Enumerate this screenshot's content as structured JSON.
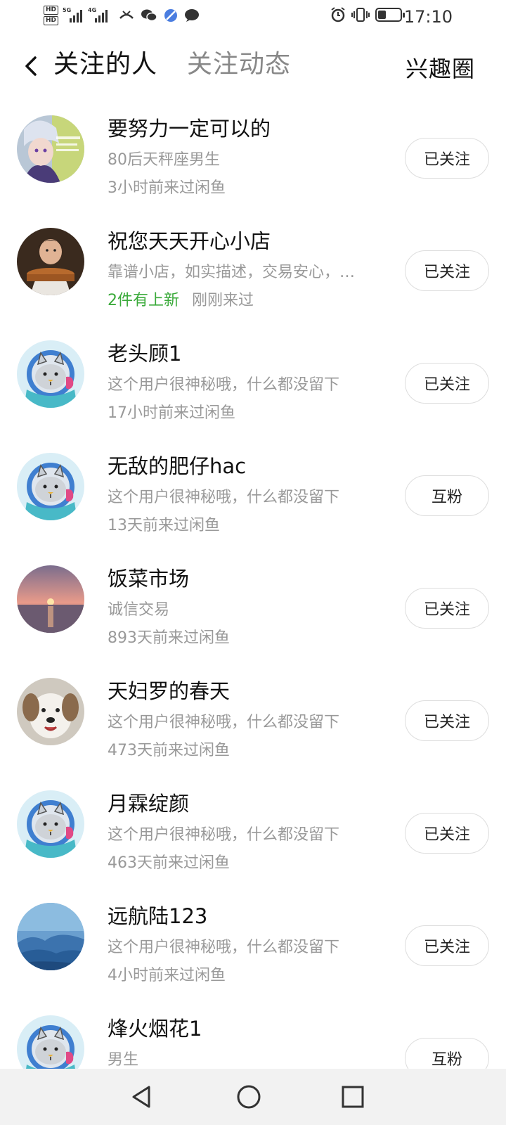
{
  "status": {
    "hd1": "HD",
    "hd2": "HD",
    "net1": "5G",
    "net2": "4G",
    "time": "17:10"
  },
  "header": {
    "tab_following": "关注的人",
    "tab_feed": "关注动态",
    "interest": "兴趣圈"
  },
  "users": [
    {
      "name": "要努力一定可以的",
      "desc": "80后天秤座男生",
      "highlight": "",
      "meta": "3小时前来过闲鱼",
      "button": "已关注",
      "avatar": "anime"
    },
    {
      "name": "祝您天天开心小店",
      "desc": "靠谱小店，如实描述，交易安心，…",
      "highlight": "2件有上新",
      "meta": "刚刚来过",
      "button": "已关注",
      "avatar": "child"
    },
    {
      "name": "老头顾1",
      "desc": "这个用户很神秘哦，什么都没留下",
      "highlight": "",
      "meta": "17小时前来过闲鱼",
      "button": "已关注",
      "avatar": "cat"
    },
    {
      "name": "无敌的肥仔hac",
      "desc": "这个用户很神秘哦，什么都没留下",
      "highlight": "",
      "meta": "13天前来过闲鱼",
      "button": "互粉",
      "avatar": "cat"
    },
    {
      "name": "饭菜市场",
      "desc": "诚信交易",
      "highlight": "",
      "meta": "893天前来过闲鱼",
      "button": "已关注",
      "avatar": "sunset"
    },
    {
      "name": "天妇罗的春天",
      "desc": "这个用户很神秘哦，什么都没留下",
      "highlight": "",
      "meta": "473天前来过闲鱼",
      "button": "已关注",
      "avatar": "dog"
    },
    {
      "name": "月霖绽颜",
      "desc": "这个用户很神秘哦，什么都没留下",
      "highlight": "",
      "meta": "463天前来过闲鱼",
      "button": "已关注",
      "avatar": "cat"
    },
    {
      "name": "远航陆123",
      "desc": "这个用户很神秘哦，什么都没留下",
      "highlight": "",
      "meta": "4小时前来过闲鱼",
      "button": "已关注",
      "avatar": "mountain"
    },
    {
      "name": "烽火烟花1",
      "desc": "男生",
      "highlight": "",
      "meta": "",
      "button": "互粉",
      "avatar": "cat"
    }
  ],
  "icons": {
    "back": "chevron-left-icon",
    "nav_back": "triangle-back-icon",
    "nav_home": "circle-home-icon",
    "nav_recent": "square-recent-icon"
  },
  "colors": {
    "highlight_green": "#3aaa3a",
    "secondary_text": "#999999",
    "nav_background": "#f2f2f2"
  }
}
